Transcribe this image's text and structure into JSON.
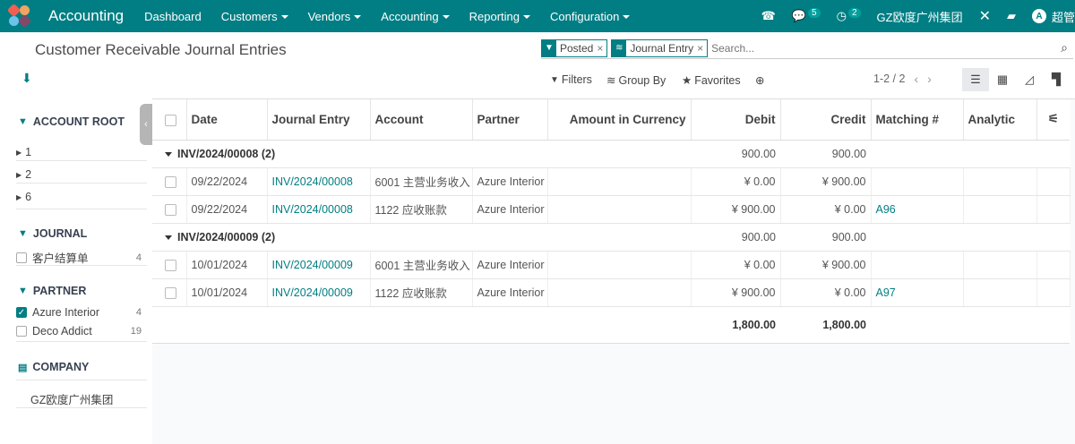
{
  "navbar": {
    "app_name": "Accounting",
    "menus": [
      "Dashboard",
      "Customers",
      "Vendors",
      "Accounting",
      "Reporting",
      "Configuration"
    ],
    "menus_with_caret": [
      false,
      true,
      true,
      true,
      true,
      true
    ],
    "chat_count": "5",
    "activity_count": "2",
    "company": "GZ欧度广州集团",
    "user_initial": "A",
    "user_name": "超管"
  },
  "page": {
    "title": "Customer Receivable Journal Entries"
  },
  "search": {
    "facets": [
      "Posted",
      "Journal Entry"
    ],
    "placeholder": "Search..."
  },
  "toolbar": {
    "filters": "Filters",
    "group_by": "Group By",
    "favorites": "Favorites",
    "pager": "1-2 / 2"
  },
  "sidebar": {
    "account_root": {
      "title": "ACCOUNT ROOT",
      "items": [
        "1",
        "2",
        "6"
      ]
    },
    "journal": {
      "title": "JOURNAL",
      "items": [
        {
          "label": "客户结算单",
          "count": "4",
          "checked": false
        }
      ]
    },
    "partner": {
      "title": "PARTNER",
      "items": [
        {
          "label": "Azure Interior",
          "count": "4",
          "checked": true
        },
        {
          "label": "Deco Addict",
          "count": "19",
          "checked": false
        }
      ]
    },
    "company": {
      "title": "COMPANY",
      "items": [
        "GZ欧度广州集团"
      ]
    }
  },
  "table": {
    "columns": [
      "Date",
      "Journal Entry",
      "Account",
      "Partner",
      "Amount in Currency",
      "Debit",
      "Credit",
      "Matching #",
      "Analytic"
    ],
    "groups": [
      {
        "label": "INV/2024/00008 (2)",
        "debit": "900.00",
        "credit": "900.00",
        "rows": [
          {
            "date": "09/22/2024",
            "entry": "INV/2024/00008",
            "account": "6001 主营业务收入",
            "partner": "Azure Interior",
            "amount_currency": "",
            "debit": "¥ 0.00",
            "credit": "¥ 900.00",
            "matching": "",
            "analytic": ""
          },
          {
            "date": "09/22/2024",
            "entry": "INV/2024/00008",
            "account": "1122 应收账款",
            "partner": "Azure Interior",
            "amount_currency": "",
            "debit": "¥ 900.00",
            "credit": "¥ 0.00",
            "matching": "A96",
            "analytic": ""
          }
        ]
      },
      {
        "label": "INV/2024/00009 (2)",
        "debit": "900.00",
        "credit": "900.00",
        "rows": [
          {
            "date": "10/01/2024",
            "entry": "INV/2024/00009",
            "account": "6001 主营业务收入",
            "partner": "Azure Interior",
            "amount_currency": "",
            "debit": "¥ 0.00",
            "credit": "¥ 900.00",
            "matching": "",
            "analytic": ""
          },
          {
            "date": "10/01/2024",
            "entry": "INV/2024/00009",
            "account": "1122 应收账款",
            "partner": "Azure Interior",
            "amount_currency": "",
            "debit": "¥ 900.00",
            "credit": "¥ 0.00",
            "matching": "A97",
            "analytic": ""
          }
        ]
      }
    ],
    "total_debit": "1,800.00",
    "total_credit": "1,800.00"
  },
  "colors": {
    "brand": "#017e84",
    "logo": [
      "#f06050",
      "#f4a460",
      "#6cc1ed",
      "#814968"
    ]
  }
}
